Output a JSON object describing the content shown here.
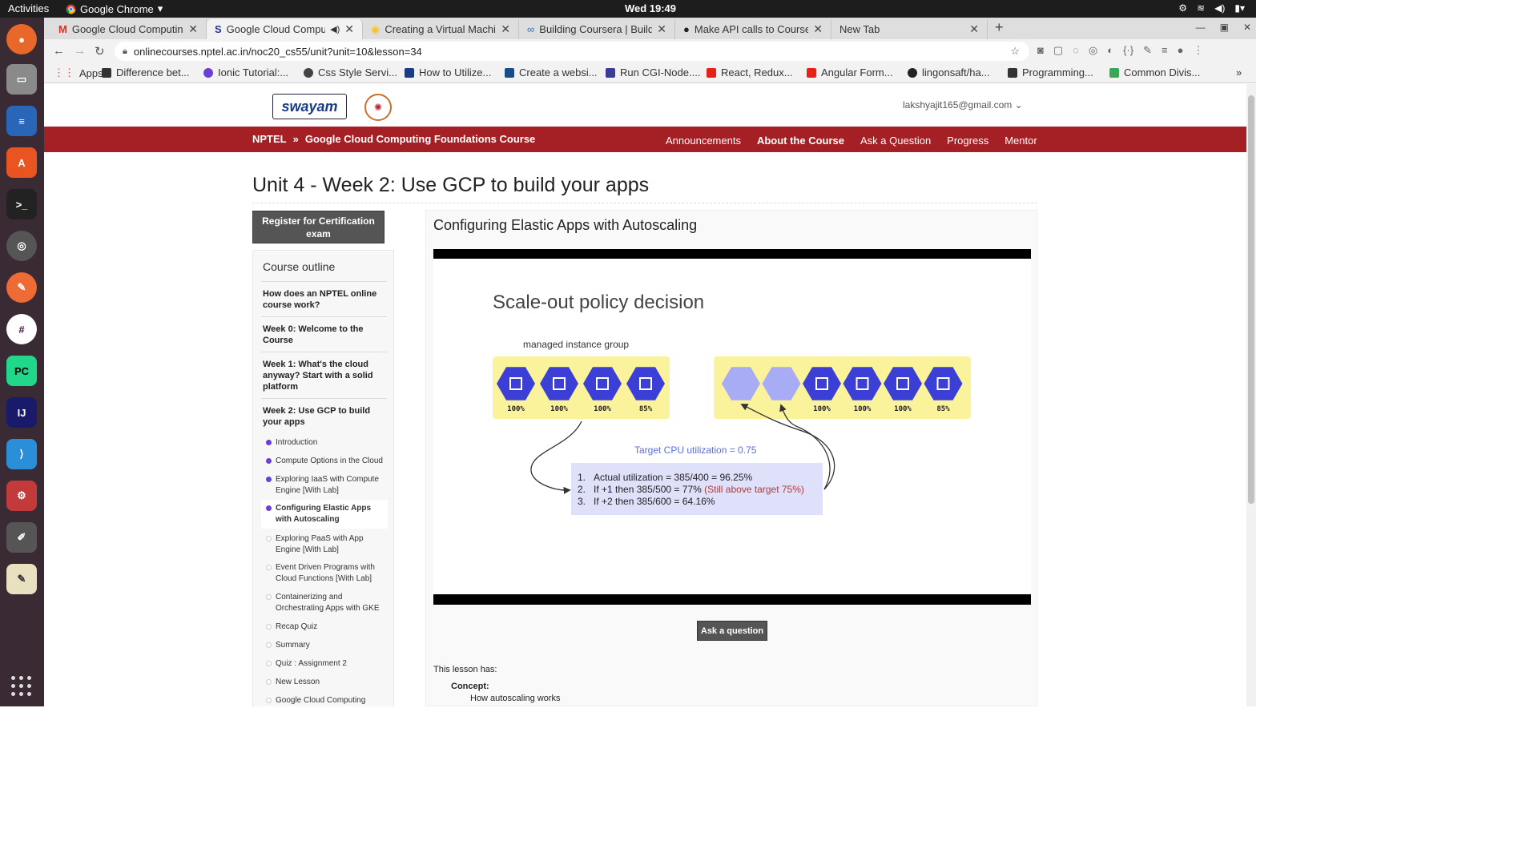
{
  "topbar": {
    "activities": "Activities",
    "app_name": "Google Chrome",
    "clock": "Wed 19:49"
  },
  "tabs": [
    {
      "title": "Google Cloud Computing",
      "favicon": "gmail-icon",
      "color": "#d93025"
    },
    {
      "title": "Google Cloud Comput",
      "favicon": "swayam-icon",
      "color": "#1a3a8a"
    },
    {
      "title": "Creating a Virtual Machin",
      "favicon": "qwiklabs-icon",
      "color": "#f6c026"
    },
    {
      "title": "Building Coursera | Buildi",
      "favicon": "coursera-icon",
      "color": "#2a73cc"
    },
    {
      "title": "Make API calls to Coursera",
      "favicon": "github-icon",
      "color": "#222222"
    },
    {
      "title": "New Tab",
      "favicon": "",
      "color": ""
    }
  ],
  "omnibox": {
    "url": "onlinecourses.nptel.ac.in/noc20_cs55/unit?unit=10&lesson=34"
  },
  "bookmarks": [
    {
      "label": "Apps",
      "color": "#e8453c"
    },
    {
      "label": "Difference bet...",
      "color": "#333333"
    },
    {
      "label": "Ionic Tutorial:...",
      "color": "#6a3fd8"
    },
    {
      "label": "Css Style Servi...",
      "color": "#444444"
    },
    {
      "label": "How to Utilize...",
      "color": "#1a3a8a"
    },
    {
      "label": "Create a websi...",
      "color": "#1a4c8a"
    },
    {
      "label": "Run CGI-Node....",
      "color": "#3b3b9a"
    },
    {
      "label": "React, Redux...",
      "color": "#e62117"
    },
    {
      "label": "Angular Form...",
      "color": "#e62117"
    },
    {
      "label": "lingonsaft/ha...",
      "color": "#222222"
    },
    {
      "label": "Programming...",
      "color": "#333333"
    },
    {
      "label": "Common Divis...",
      "color": "#3aa757"
    }
  ],
  "site": {
    "logo_text": "swayam",
    "email": "lakshyajit165@gmail.com ⌄",
    "breadcrumb": {
      "root": "NPTEL",
      "sep": "»",
      "course": "Google Cloud Computing Foundations Course"
    },
    "menu": [
      "Announcements",
      "About the Course",
      "Ask a Question",
      "Progress",
      "Mentor"
    ],
    "brand_color": "#a52024"
  },
  "page_title": "Unit 4 - Week 2: Use GCP to build your apps",
  "register_button": "Register for Certification exam",
  "outline": {
    "heading": "Course outline",
    "weeks": [
      "How does an NPTEL online course work?",
      "Week 0: Welcome to the Course",
      "Week 1: What's the cloud anyway? Start with a solid platform",
      "Week 2: Use GCP to build your apps"
    ],
    "lessons": [
      {
        "label": "Introduction",
        "status": "done"
      },
      {
        "label": "Compute Options in the Cloud",
        "status": "done"
      },
      {
        "label": "Exploring IaaS with Compute Engine [With Lab]",
        "status": "done"
      },
      {
        "label": "Configuring Elastic Apps with Autoscaling",
        "status": "current"
      },
      {
        "label": "Exploring PaaS with App Engine [With Lab]",
        "status": "todo"
      },
      {
        "label": "Event Driven Programs with Cloud Functions [With Lab]",
        "status": "todo"
      },
      {
        "label": "Containerizing and Orchestrating Apps with GKE",
        "status": "todo"
      },
      {
        "label": "Recap Quiz",
        "status": "todo"
      },
      {
        "label": "Summary",
        "status": "todo"
      },
      {
        "label": "Quiz : Assignment 2",
        "status": "todo"
      },
      {
        "label": "New Lesson",
        "status": "todo"
      },
      {
        "label": "Google Cloud Computing",
        "status": "todo"
      }
    ]
  },
  "lesson": {
    "title": "Configuring Elastic Apps with Autoscaling",
    "slide": {
      "title": "Scale-out policy decision",
      "group_label": "managed instance group",
      "left_group": [
        "100%",
        "100%",
        "100%",
        "85%"
      ],
      "right_group": [
        "",
        "",
        "100%",
        "100%",
        "100%",
        "85%"
      ],
      "target": "Target CPU utilization = 0.75",
      "steps": [
        {
          "text": "Actual utilization = 385/400 = 96.25%",
          "note": ""
        },
        {
          "text": "If +1 then 385/500 = 77%",
          "note": "(Still above target 75%)"
        },
        {
          "text": "If +2 then 385/600 = 64.16%",
          "note": ""
        }
      ]
    },
    "ask_button": "Ask a question",
    "this_lesson_has": "This lesson has:",
    "concept_label": "Concept:",
    "concept_desc": "How autoscaling works"
  }
}
